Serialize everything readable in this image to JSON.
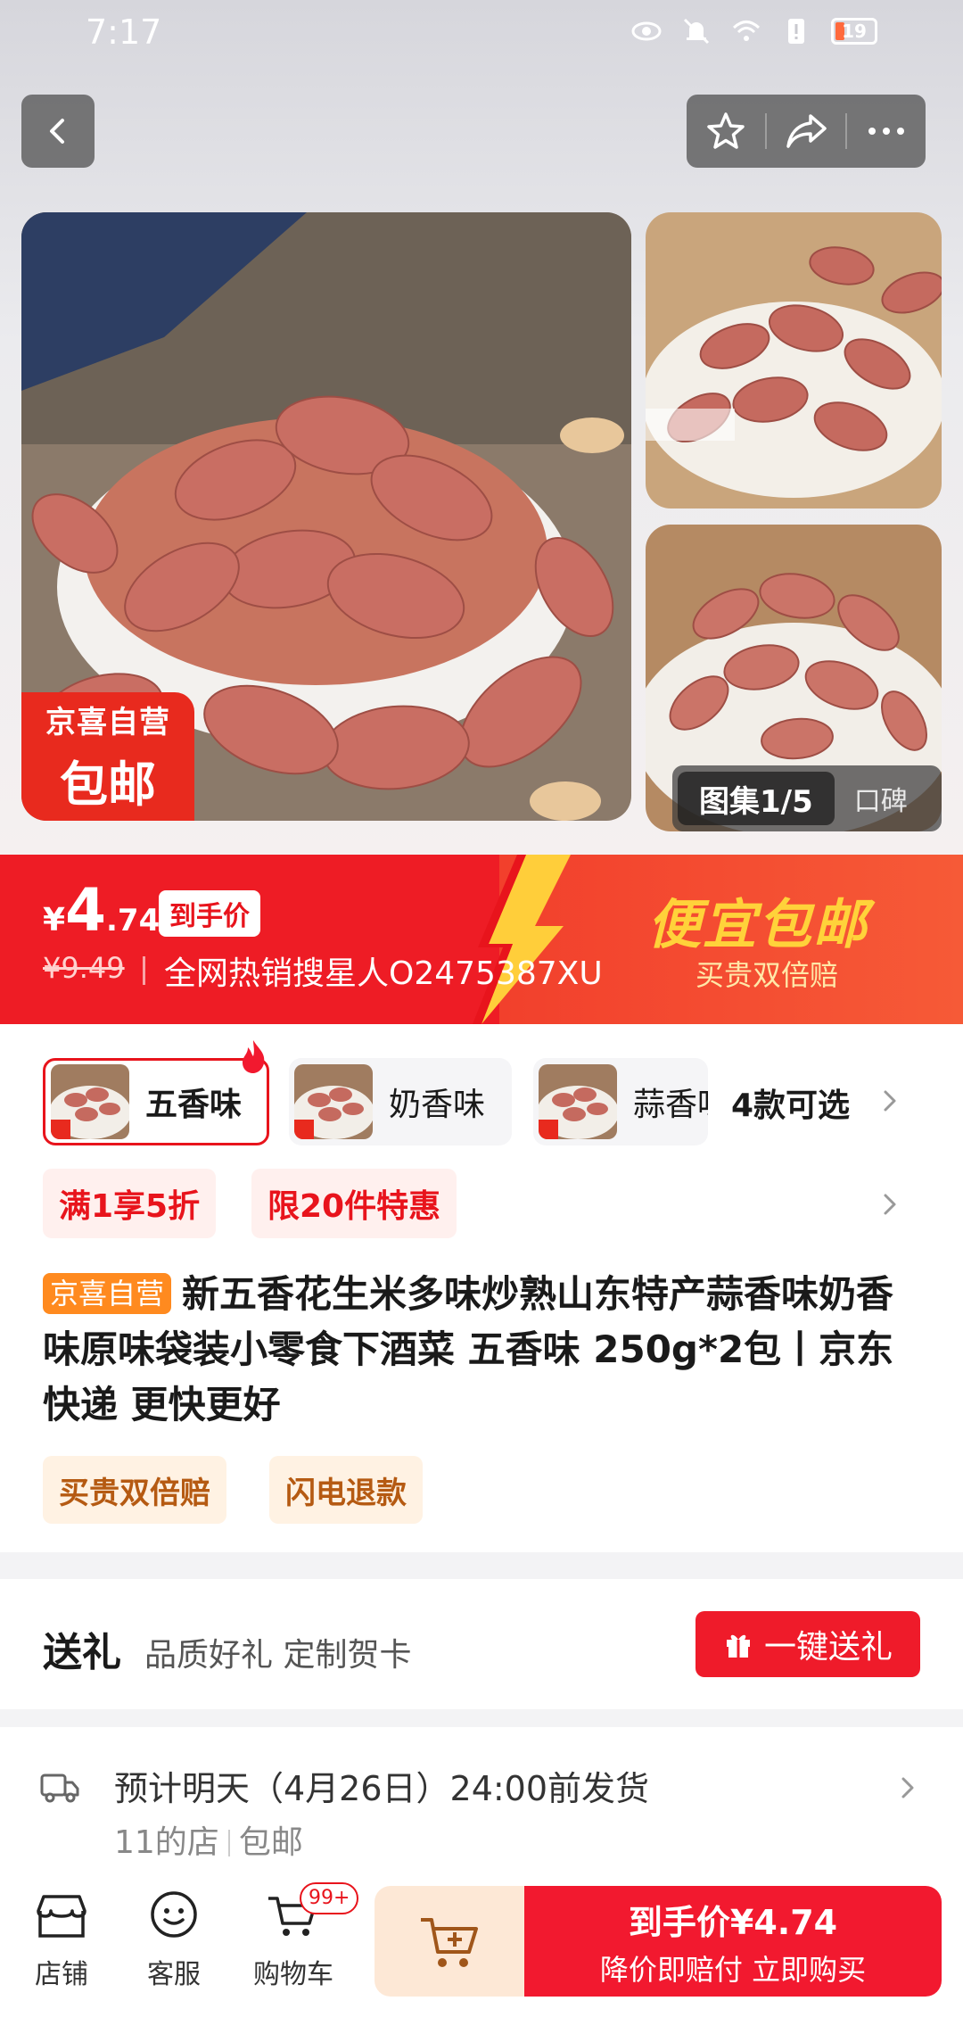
{
  "status_bar": {
    "time": "7:17",
    "battery": "19"
  },
  "header": {
    "back_icon": "chevron-left-icon",
    "actions": [
      "star-icon",
      "share-icon",
      "more-icon"
    ]
  },
  "gallery": {
    "badge_line1": "京喜自营",
    "badge_line2": "包邮",
    "counter": "图集1/5",
    "review_tab": "口碑"
  },
  "price": {
    "currency": "¥",
    "integer": "4",
    "decimal": ".74",
    "tag": "到手价",
    "original": "¥9.49",
    "desc": "全网热销搜星人O2475387XU",
    "promo_big": "便宜包邮",
    "promo_small": "买贵双倍赔"
  },
  "variants": {
    "items": [
      {
        "label": "五香味",
        "selected": true
      },
      {
        "label": "奶香味",
        "selected": false
      },
      {
        "label": "蒜香味",
        "selected": false
      }
    ],
    "count_label": "4款可选"
  },
  "coupons": [
    "满1享5折",
    "限20件特惠"
  ],
  "product": {
    "tag": "京喜自营",
    "title": "新五香花生米多味炒熟山东特产蒜香味奶香味原味袋装小零食下酒菜 五香味 250g*2包丨京东快递 更快更好"
  },
  "services": [
    "买贵双倍赔",
    "闪电退款"
  ],
  "gift": {
    "title": "送礼",
    "desc": "品质好礼 定制贺卡",
    "button": "一键送礼"
  },
  "delivery": {
    "line1": "预计明天（4月26日）24:00前发货",
    "shop": "11的店",
    "shipping": "包邮"
  },
  "bottom_bar": {
    "store": "店铺",
    "service": "客服",
    "cart": "购物车",
    "cart_badge": "99+",
    "buy_line1": "到手价¥4.74",
    "buy_line2": "降价即赔付 立即购买"
  },
  "colors": {
    "brand_red": "#ee1c25",
    "accent_orange": "#ff8a1f",
    "promo_yellow": "#ffd23a"
  }
}
